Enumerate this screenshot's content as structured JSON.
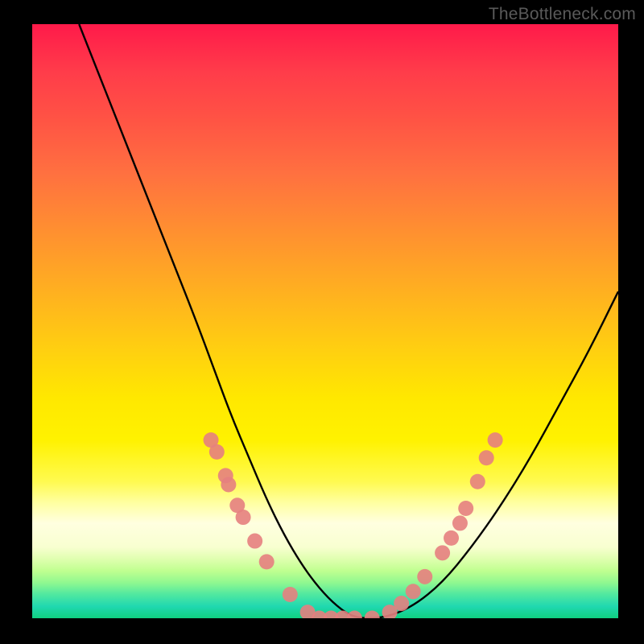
{
  "watermark": "TheBottleneck.com",
  "chart_data": {
    "type": "line",
    "title": "",
    "xlabel": "",
    "ylabel": "",
    "xlim": [
      0,
      100
    ],
    "ylim": [
      0,
      100
    ],
    "grid": false,
    "legend": false,
    "series": [
      {
        "name": "bottleneck-curve",
        "x": [
          8,
          12,
          16,
          20,
          24,
          28,
          31,
          34,
          37,
          40,
          43,
          46,
          49,
          52,
          55,
          60,
          65,
          70,
          75,
          80,
          85,
          90,
          95,
          100
        ],
        "values": [
          100,
          90,
          80,
          70,
          60,
          50,
          42,
          34,
          27,
          20,
          14,
          9,
          5,
          2,
          0,
          0,
          2,
          6,
          12,
          19,
          27,
          36,
          45,
          55
        ],
        "color": "#000000"
      }
    ],
    "markers": {
      "name": "highlight-markers",
      "color": "#e58080",
      "points": [
        {
          "x": 30.5,
          "y": 30
        },
        {
          "x": 31.5,
          "y": 28
        },
        {
          "x": 33,
          "y": 24
        },
        {
          "x": 33.5,
          "y": 22.5
        },
        {
          "x": 35,
          "y": 19
        },
        {
          "x": 36,
          "y": 17
        },
        {
          "x": 38,
          "y": 13
        },
        {
          "x": 40,
          "y": 9.5
        },
        {
          "x": 44,
          "y": 4
        },
        {
          "x": 47,
          "y": 1
        },
        {
          "x": 49,
          "y": 0
        },
        {
          "x": 51,
          "y": 0
        },
        {
          "x": 53,
          "y": 0
        },
        {
          "x": 55,
          "y": 0
        },
        {
          "x": 58,
          "y": 0
        },
        {
          "x": 61,
          "y": 1
        },
        {
          "x": 63,
          "y": 2.5
        },
        {
          "x": 65,
          "y": 4.5
        },
        {
          "x": 67,
          "y": 7
        },
        {
          "x": 70,
          "y": 11
        },
        {
          "x": 71.5,
          "y": 13.5
        },
        {
          "x": 73,
          "y": 16
        },
        {
          "x": 74,
          "y": 18.5
        },
        {
          "x": 76,
          "y": 23
        },
        {
          "x": 77.5,
          "y": 27
        },
        {
          "x": 79,
          "y": 30
        }
      ]
    },
    "background_gradient": {
      "top": "#ff1a4a",
      "mid_upper": "#ffb020",
      "mid": "#fff200",
      "mid_lower": "#ffffe0",
      "bottom": "#10d080"
    }
  }
}
